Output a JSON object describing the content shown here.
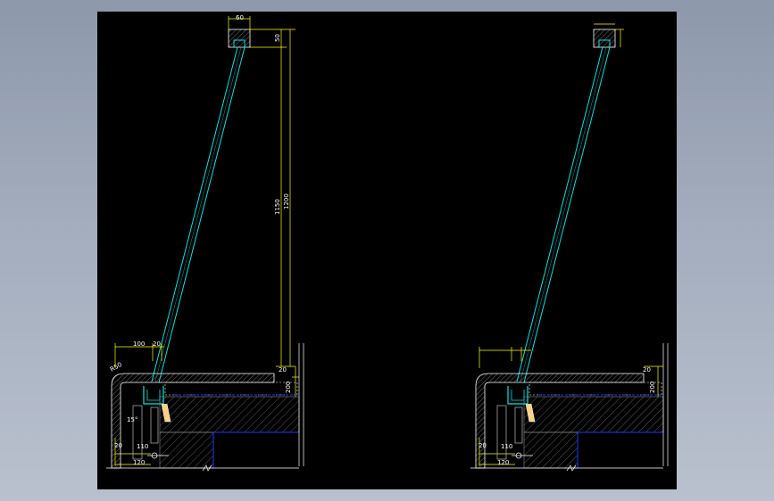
{
  "drawing": {
    "left_section": {
      "dims": {
        "top_width": "60",
        "top_height": "50",
        "overall_height": "1200",
        "glass_height": "1150",
        "sill_width": "100",
        "sill_offset": "20",
        "corner_radius": "R50",
        "slab_depth": "200",
        "slab_gap": "20",
        "angle": "15°",
        "base_gap": "20",
        "base_width": "110",
        "base_total": "120"
      }
    },
    "right_section": {
      "dims": {
        "slab_depth": "200",
        "slab_gap": "20",
        "base_gap": "20",
        "base_width": "110",
        "base_total": "120"
      }
    }
  },
  "colors": {
    "background": "#000000",
    "glass": "#00e5e5",
    "dimension": "#ffff00",
    "slab": "#ffffff",
    "hatch": "#6e6e6e",
    "beam": "#1a3cff",
    "text": "#ffffff"
  }
}
